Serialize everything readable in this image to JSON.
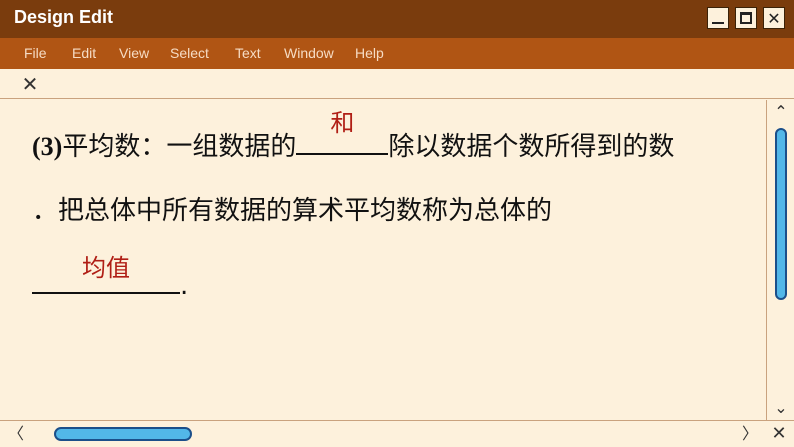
{
  "window": {
    "title": "Design Edit",
    "minimize_icon": "minimize-icon",
    "maximize_icon": "maximize-icon",
    "close_glyph": "✕"
  },
  "menu": {
    "items": [
      "File",
      "Edit",
      "View",
      "Select",
      "Text",
      "Window",
      "Help"
    ]
  },
  "tab": {
    "close_glyph": "✕"
  },
  "document": {
    "line1": {
      "number": "(3)",
      "before_blank": "平均数：一组数据的",
      "blank_answer": "和",
      "after_blank": "除以数据个数所得到的数"
    },
    "line2": {
      "text": "．把总体中所有数据的算术平均数称为总体的"
    },
    "line3": {
      "blank_answer": "均值",
      "after_blank": "."
    }
  },
  "scrollbars": {
    "up_glyph": "⌃",
    "down_glyph": "⌄",
    "left_glyph": "〈",
    "right_glyph": "〉",
    "corner_close_glyph": "✕"
  },
  "colors": {
    "titlebar": "#7a3c0d",
    "menubar": "#b05514",
    "background": "#fdf1dc",
    "answer": "#b01e15",
    "scroll_thumb": "#52b7e8"
  }
}
